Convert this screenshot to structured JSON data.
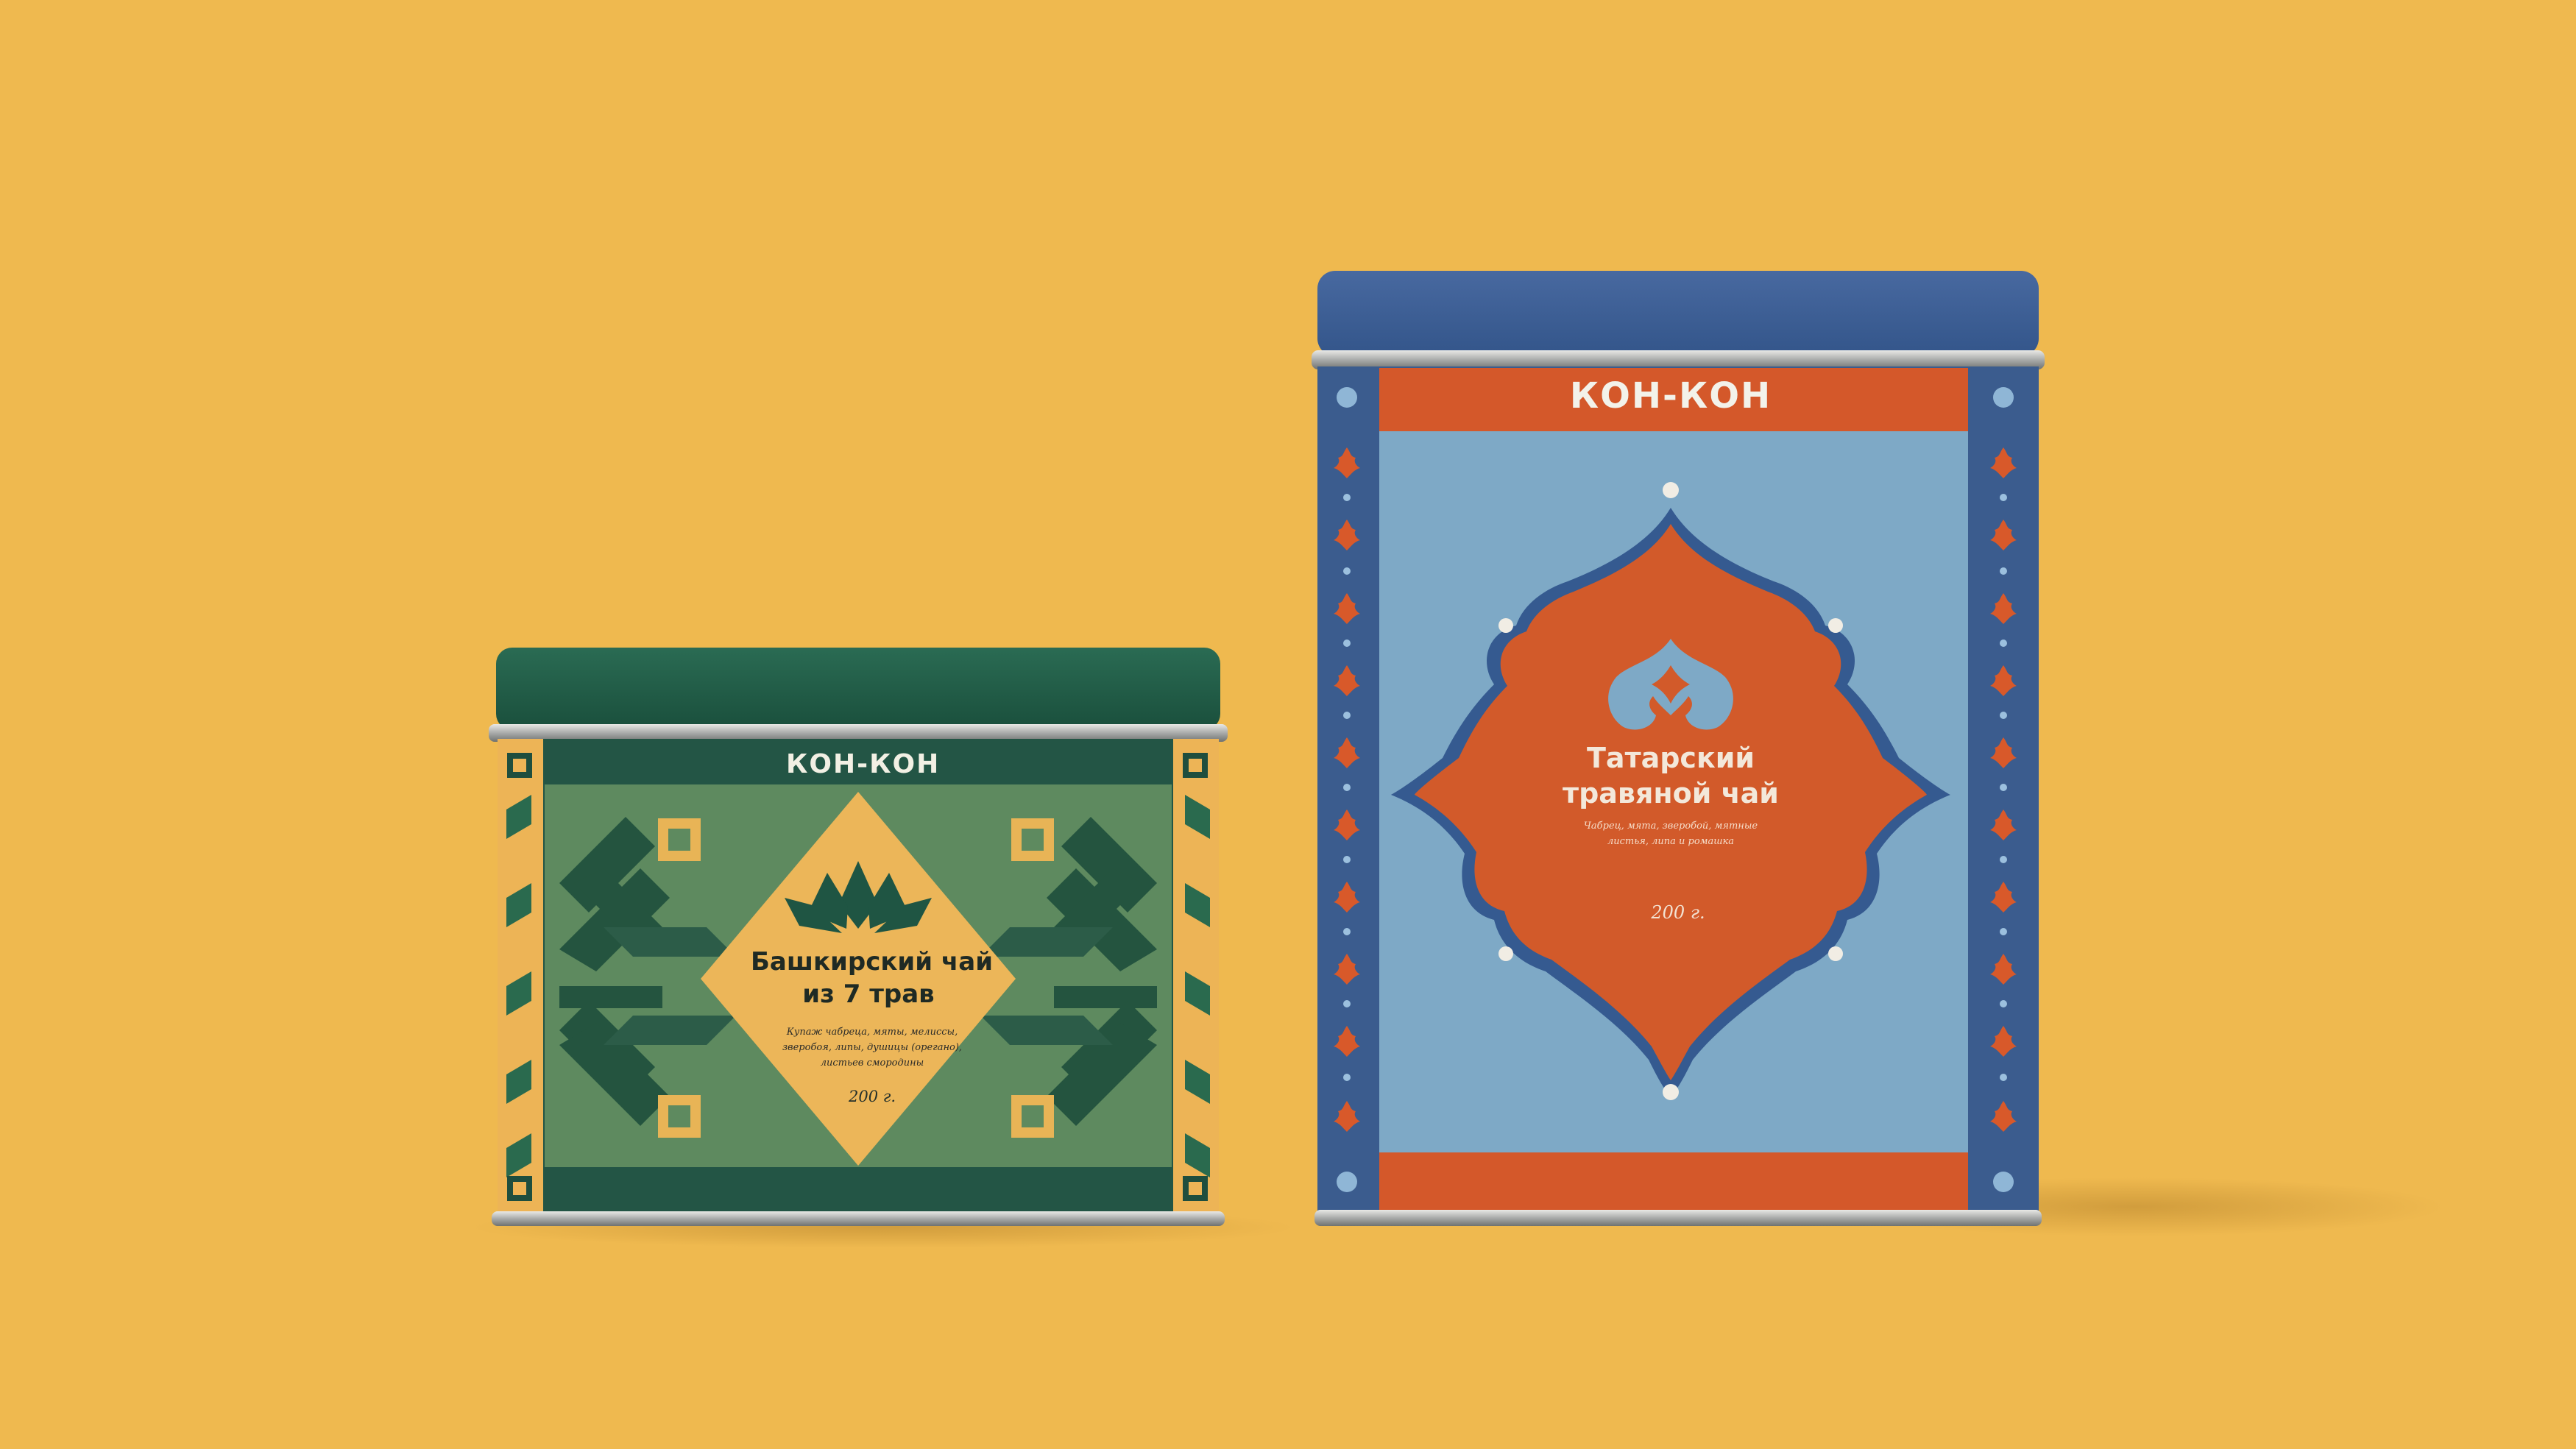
{
  "background_color": "#EFB94F",
  "left_tin": {
    "brand": "КОН-КОН",
    "title_line1": "Башкирский чай",
    "title_line2": "из 7 трав",
    "description": "Купаж чабреца, мяты, мелиссы, зверобоя, липы, душицы (орегано), листьев смородины",
    "weight": "200 г.",
    "colors": {
      "lid": "#1E5A45",
      "label": "#5E8A5F",
      "dark": "#235545",
      "accent": "#EDB456",
      "diamond": "#ECB659"
    },
    "icons": [
      "leaf-emblem-icon",
      "square-ornament-icon"
    ]
  },
  "right_tin": {
    "brand": "КОН-КОН",
    "title_line1": "Татарский",
    "title_line2": "травяной чай",
    "description": "Чабрец, мята, зверобой, мятные листья, липа и ромашка",
    "weight": "200 г.",
    "colors": {
      "lid": "#3A5C8F",
      "side": "#3B5C8E",
      "band": "#D4582A",
      "panel": "#7EA9C6",
      "medallion": "#D25A2A"
    },
    "icons": [
      "tulip-emblem-icon",
      "tulip-ornament-icon",
      "dot-ornament-icon"
    ]
  }
}
